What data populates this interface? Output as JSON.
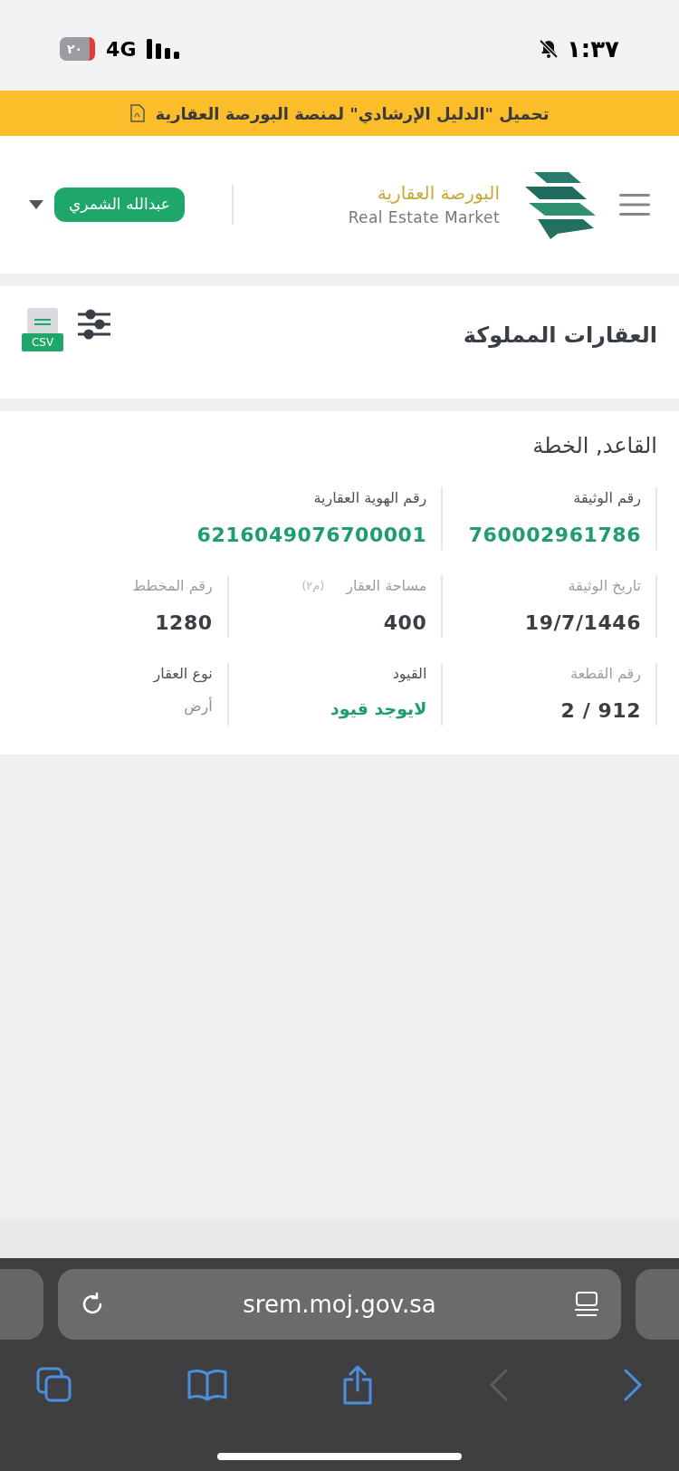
{
  "status_bar": {
    "time": "١:٣٧",
    "network": "4G",
    "battery": "٢٠",
    "silent": true
  },
  "banner": {
    "text": "تحميل \"الدليل الإرشادي\" لمنصة البورصة العقارية"
  },
  "header": {
    "logo_arabic": "البورصة العقارية",
    "logo_english": "Real Estate Market",
    "user_name": "عبدالله الشمري"
  },
  "section": {
    "title": "العقارات المملوكة",
    "export_label": "CSV"
  },
  "property": {
    "title": "القاعد, الخطة",
    "rows": [
      [
        {
          "label": "رقم الوثيقة",
          "value": "760002961786",
          "kind": "accent"
        },
        {
          "label": "رقم الهوية العقارية",
          "value": "6216049076700001",
          "kind": "accent",
          "wide": true
        }
      ],
      [
        {
          "label": "تاريخ الوثيقة",
          "value": "19/7/1446",
          "kind": "bold"
        },
        {
          "label": "مساحة العقار",
          "unit": "(م٢)",
          "value": "400",
          "kind": "bold"
        },
        {
          "label": "رقم المخطط",
          "value": "1280",
          "kind": "bold"
        }
      ],
      [
        {
          "label": "رقم القطعة",
          "value": "2 / 912",
          "kind": "bold"
        },
        {
          "label": "القيود",
          "value": "لايوجد قيود",
          "kind": "status"
        },
        {
          "label": "نوع العقار",
          "value": "أرض",
          "kind": "plain"
        }
      ]
    ]
  },
  "browser": {
    "url": "srem.moj.gov.sa",
    "back_disabled": true,
    "forward_disabled": false
  }
}
